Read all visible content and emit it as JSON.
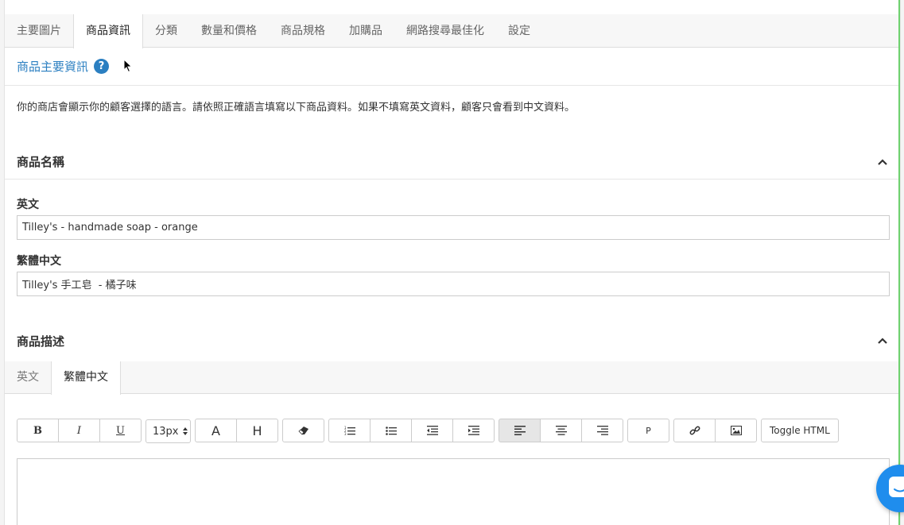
{
  "tabs": [
    {
      "label": "主要圖片"
    },
    {
      "label": "商品資訊"
    },
    {
      "label": "分類"
    },
    {
      "label": "數量和價格"
    },
    {
      "label": "商品規格"
    },
    {
      "label": "加購品"
    },
    {
      "label": "網路搜尋最佳化"
    },
    {
      "label": "設定"
    }
  ],
  "active_tab": "商品資訊",
  "section": {
    "title": "商品主要資訊",
    "help_icon": "question-circle-icon"
  },
  "notice": "你的商店會顯示你的顧客選擇的語言。請依照正確語言填寫以下商品資料。如果不填寫英文資料，顧客只會看到中文資料。",
  "name_group": {
    "title": "商品名稱",
    "english_label": "英文",
    "english_value": "Tilley's - handmade soap - orange",
    "chinese_label": "繁體中文",
    "chinese_value": "Tilley's 手工皂  - 橘子味"
  },
  "desc_group": {
    "title": "商品描述",
    "tabs": [
      {
        "label": "英文"
      },
      {
        "label": "繁體中文"
      }
    ],
    "active_tab": "繁體中文"
  },
  "toolbar": {
    "bold": "B",
    "italic": "I",
    "underline": "U",
    "font_size": "13px",
    "font_color": "A",
    "highlight": "H",
    "paragraph": "P",
    "toggle_html": "Toggle HTML"
  },
  "colors": {
    "accent": "#2b7fc1",
    "chat": "#1f8ded",
    "edge": "#6fd26f"
  }
}
